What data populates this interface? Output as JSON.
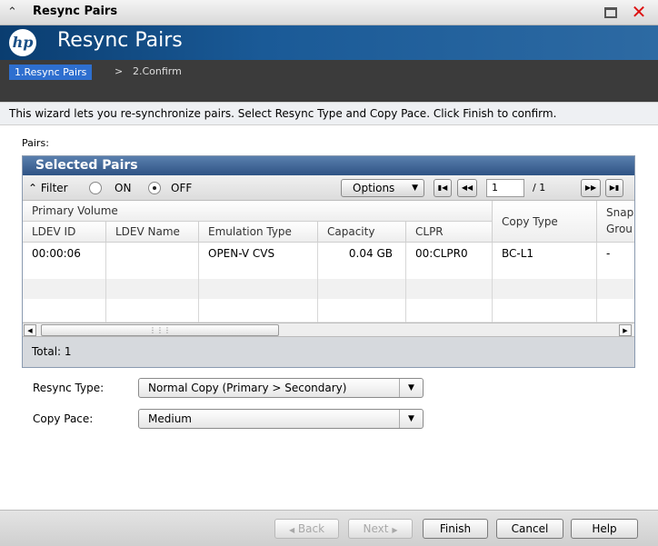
{
  "window": {
    "title": "Resync Pairs",
    "collapse_icon": "double-chevron-up-icon",
    "maximize_icon": "maximize-icon",
    "close_icon": "close-icon",
    "close_glyph": "✕"
  },
  "banner": {
    "logo_text": "hp",
    "heading": "Resync Pairs"
  },
  "steps": {
    "step1": "1.Resync Pairs",
    "separator": ">",
    "step2": "2.Confirm"
  },
  "description": "This wizard lets you re-synchronize pairs. Select Resync Type and Copy Pace. Click Finish to confirm.",
  "pairs_label": "Pairs:",
  "panel": {
    "title": "Selected Pairs",
    "toolbar": {
      "filter_label": "Filter",
      "on_label": "ON",
      "off_label": "OFF",
      "filter_state": "OFF",
      "options_label": "Options",
      "page_value": "1",
      "page_total": "/ 1"
    },
    "table": {
      "group_header": "Primary Volume",
      "columns": [
        "LDEV ID",
        "LDEV Name",
        "Emulation Type",
        "Capacity",
        "CLPR",
        "Copy Type",
        "Snap Grou"
      ],
      "snap_header_line1": "Snap",
      "snap_header_line2": "Grou",
      "rows": [
        [
          "00:00:06",
          "",
          "OPEN-V CVS",
          "0.04 GB",
          "00:CLPR0",
          "BC-L1",
          "-"
        ]
      ]
    },
    "total_label": "Total:  1"
  },
  "form": {
    "resync_type_label": "Resync Type:",
    "resync_type_value": "Normal Copy (Primary > Secondary)",
    "copy_pace_label": "Copy Pace:",
    "copy_pace_value": "Medium"
  },
  "buttons": {
    "back": "Back",
    "next": "Next",
    "finish": "Finish",
    "cancel": "Cancel",
    "help": "Help"
  },
  "colors": {
    "banner": "#1a5a97",
    "active_step": "#2e6fcf",
    "panel_header": "#2e5384",
    "close": "#dd1111"
  }
}
